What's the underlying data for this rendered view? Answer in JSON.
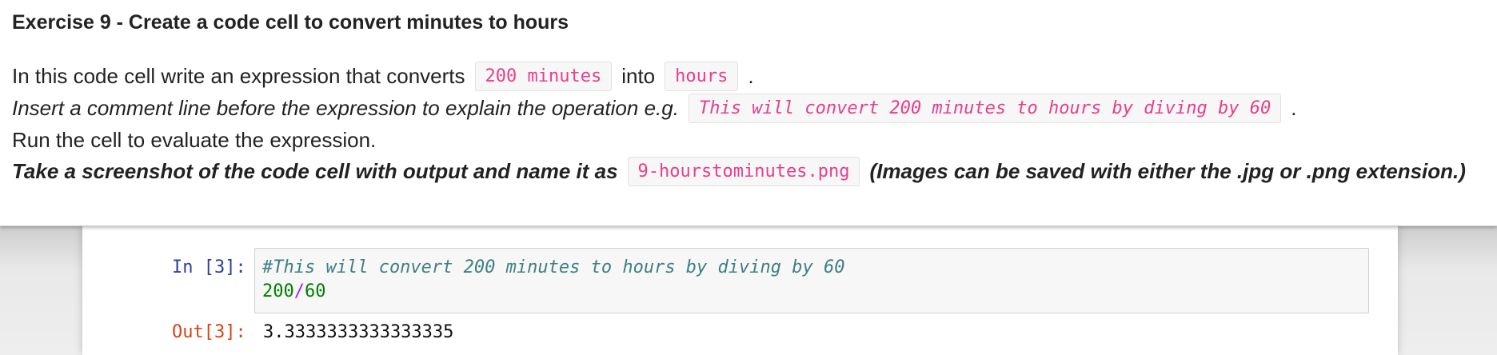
{
  "exercise": {
    "title": "Exercise 9 - Create a code cell to convert minutes to hours",
    "line1": {
      "a": "In this code cell write an expression that converts",
      "code1": "200 minutes",
      "b": "into",
      "code2": "hours",
      "c": "."
    },
    "line2": {
      "a": "Insert a comment line before the expression to explain the operation e.g.",
      "code": "This will convert 200 minutes to hours by diving by 60",
      "c": "."
    },
    "line3": "Run the cell to evaluate the expression.",
    "line4": {
      "a": "Take a screenshot of the code cell with output and name it as",
      "code": "9-hourstominutes.png",
      "b": "(Images can be saved with either the .jpg or .png extension.)"
    }
  },
  "cell": {
    "in_prompt": "In [3]:",
    "comment": "#This will convert 200 minutes to hours by diving by 60",
    "expr_left": "200",
    "expr_op": "/",
    "expr_right": "60",
    "out_prompt": "Out[3]:",
    "output": "3.3333333333333335"
  },
  "colors": {
    "inline_code": "#e83e8c",
    "in_prompt": "#303f9f",
    "out_prompt": "#d84315",
    "comment": "#408080",
    "number": "#008000",
    "operator": "#aa22ff"
  }
}
